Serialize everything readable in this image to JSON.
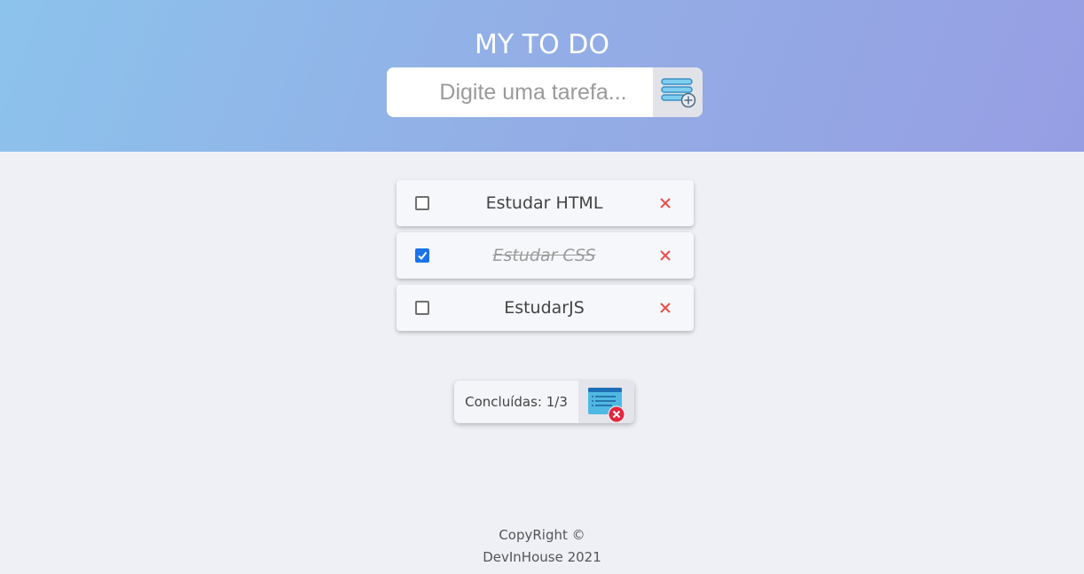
{
  "header": {
    "title": "MY TO DO",
    "input_placeholder": "Digite uma tarefa...",
    "input_value": "",
    "add_icon": "add-list-icon"
  },
  "tasks": [
    {
      "text": "Estudar HTML",
      "done": false,
      "delete_icon": "close-icon"
    },
    {
      "text": "Estudar CSS",
      "done": true,
      "delete_icon": "close-icon"
    },
    {
      "text": "EstudarJS",
      "done": false,
      "delete_icon": "close-icon"
    }
  ],
  "summary": {
    "label": "Concluídas: 1/3",
    "clear_icon": "clear-list-icon"
  },
  "footer": {
    "line1": "CopyRight ©",
    "line2": "DevInHouse 2021"
  },
  "colors": {
    "header_gradient_start": "#8cc3ec",
    "header_gradient_end": "#969ee3",
    "background": "#eff0f5",
    "delete_red": "#e8524a",
    "checkbox_blue": "#1a73e8"
  }
}
